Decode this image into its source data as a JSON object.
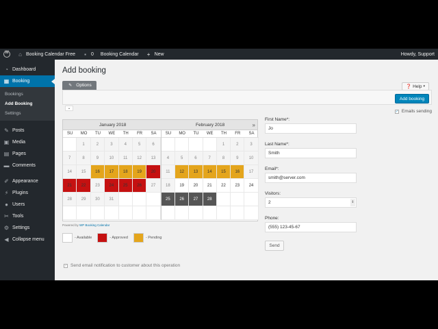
{
  "adminbar": {
    "site_name": "Booking Calendar Free",
    "comments_count": "0",
    "plugin_link": "Booking Calendar",
    "new_label": "New",
    "howdy": "Howdy, Support"
  },
  "sidebar": {
    "items_top": [
      {
        "label": "Dashboard",
        "icon": "dashboard-icon"
      },
      {
        "label": "Booking",
        "icon": "booking-icon",
        "current": true
      }
    ],
    "submenu": [
      {
        "label": "Bookings"
      },
      {
        "label": "Add Booking",
        "active": true
      },
      {
        "label": "Settings"
      }
    ],
    "items_mid": [
      {
        "label": "Posts"
      },
      {
        "label": "Media"
      },
      {
        "label": "Pages"
      },
      {
        "label": "Comments"
      }
    ],
    "items_bottom": [
      {
        "label": "Appearance"
      },
      {
        "label": "Plugins"
      },
      {
        "label": "Users"
      },
      {
        "label": "Tools"
      },
      {
        "label": "Settings"
      },
      {
        "label": "Collapse menu"
      }
    ]
  },
  "page": {
    "title": "Add booking",
    "options_tab": "Options",
    "help_label": "Help",
    "add_booking_button": "Add booking",
    "emails_sending": "Emails sending",
    "collapse_glyph": "⌄"
  },
  "calendar": {
    "next_glyph": "»",
    "dow": [
      "SU",
      "MO",
      "TU",
      "WE",
      "TH",
      "FR",
      "SA"
    ],
    "months": [
      {
        "name": "January 2018",
        "weeks": [
          [
            {
              "d": "",
              "s": "empty"
            },
            {
              "d": "1",
              "s": "past"
            },
            {
              "d": "2",
              "s": "past"
            },
            {
              "d": "3",
              "s": "past"
            },
            {
              "d": "4",
              "s": "past"
            },
            {
              "d": "5",
              "s": "past"
            },
            {
              "d": "6",
              "s": "past"
            }
          ],
          [
            {
              "d": "7",
              "s": "past"
            },
            {
              "d": "8",
              "s": "past"
            },
            {
              "d": "9",
              "s": "past"
            },
            {
              "d": "10",
              "s": "past"
            },
            {
              "d": "11",
              "s": "past"
            },
            {
              "d": "12",
              "s": "past"
            },
            {
              "d": "13",
              "s": "past"
            }
          ],
          [
            {
              "d": "14",
              "s": "past"
            },
            {
              "d": "15",
              "s": "past"
            },
            {
              "d": "16",
              "s": "pending"
            },
            {
              "d": "17",
              "s": "pending"
            },
            {
              "d": "18",
              "s": "pending"
            },
            {
              "d": "19",
              "s": "pending"
            },
            {
              "d": "20",
              "s": "approved"
            }
          ],
          [
            {
              "d": "21",
              "s": "approved"
            },
            {
              "d": "22",
              "s": "approved"
            },
            {
              "d": "23",
              "s": "past"
            },
            {
              "d": "24",
              "s": "approved"
            },
            {
              "d": "25",
              "s": "approved"
            },
            {
              "d": "26",
              "s": "approved"
            },
            {
              "d": "27",
              "s": "past"
            }
          ],
          [
            {
              "d": "28",
              "s": "past"
            },
            {
              "d": "29",
              "s": "past"
            },
            {
              "d": "30",
              "s": "past"
            },
            {
              "d": "31",
              "s": "past"
            },
            {
              "d": "",
              "s": "empty"
            },
            {
              "d": "",
              "s": "empty"
            },
            {
              "d": "",
              "s": "empty"
            }
          ],
          [
            {
              "d": "",
              "s": "empty"
            },
            {
              "d": "",
              "s": "empty"
            },
            {
              "d": "",
              "s": "empty"
            },
            {
              "d": "",
              "s": "empty"
            },
            {
              "d": "",
              "s": "empty"
            },
            {
              "d": "",
              "s": "empty"
            },
            {
              "d": "",
              "s": "empty"
            }
          ]
        ]
      },
      {
        "name": "February 2018",
        "weeks": [
          [
            {
              "d": "",
              "s": "empty"
            },
            {
              "d": "",
              "s": "empty"
            },
            {
              "d": "",
              "s": "empty"
            },
            {
              "d": "",
              "s": "empty"
            },
            {
              "d": "1",
              "s": "past"
            },
            {
              "d": "2",
              "s": "past"
            },
            {
              "d": "3",
              "s": "past"
            }
          ],
          [
            {
              "d": "4",
              "s": "past"
            },
            {
              "d": "5",
              "s": "past"
            },
            {
              "d": "6",
              "s": "past"
            },
            {
              "d": "7",
              "s": "past"
            },
            {
              "d": "8",
              "s": "past"
            },
            {
              "d": "9",
              "s": "past"
            },
            {
              "d": "10",
              "s": "past"
            }
          ],
          [
            {
              "d": "11",
              "s": "past"
            },
            {
              "d": "12",
              "s": "pending"
            },
            {
              "d": "13",
              "s": "pending"
            },
            {
              "d": "14",
              "s": "pending"
            },
            {
              "d": "15",
              "s": "pending"
            },
            {
              "d": "16",
              "s": "pending"
            },
            {
              "d": "17",
              "s": "past"
            }
          ],
          [
            {
              "d": "18",
              "s": "past"
            },
            {
              "d": "19",
              "s": "available"
            },
            {
              "d": "20",
              "s": "available"
            },
            {
              "d": "21",
              "s": "available"
            },
            {
              "d": "22",
              "s": "available"
            },
            {
              "d": "23",
              "s": "available"
            },
            {
              "d": "24",
              "s": "available"
            }
          ],
          [
            {
              "d": "25",
              "s": "booked"
            },
            {
              "d": "26",
              "s": "booked"
            },
            {
              "d": "27",
              "s": "booked"
            },
            {
              "d": "28",
              "s": "booked"
            },
            {
              "d": "",
              "s": "empty"
            },
            {
              "d": "",
              "s": "empty"
            },
            {
              "d": "",
              "s": "empty"
            }
          ],
          [
            {
              "d": "",
              "s": "empty"
            },
            {
              "d": "",
              "s": "empty"
            },
            {
              "d": "",
              "s": "empty"
            },
            {
              "d": "",
              "s": "empty"
            },
            {
              "d": "",
              "s": "empty"
            },
            {
              "d": "",
              "s": "empty"
            },
            {
              "d": "",
              "s": "empty"
            }
          ]
        ]
      }
    ],
    "powered_prefix": "Powered by",
    "powered_link": "WP Booking Calendar",
    "legend": [
      {
        "label": "- Available",
        "color": "#ffffff"
      },
      {
        "label": "- Approved",
        "color": "#c51111"
      },
      {
        "label": "- Pending",
        "color": "#e4a51c"
      }
    ]
  },
  "form": {
    "first_name_label": "First Name*:",
    "first_name_value": "Jo",
    "last_name_label": "Last Name*:",
    "last_name_value": "Smith",
    "email_label": "Email*:",
    "email_value": "smith@server.com",
    "visitors_label": "Visitors:",
    "visitors_value": "2",
    "phone_label": "Phone:",
    "phone_value": "(555) 123-45-67",
    "send_label": "Send"
  },
  "notify_label": "Send email notification to customer about this operation"
}
